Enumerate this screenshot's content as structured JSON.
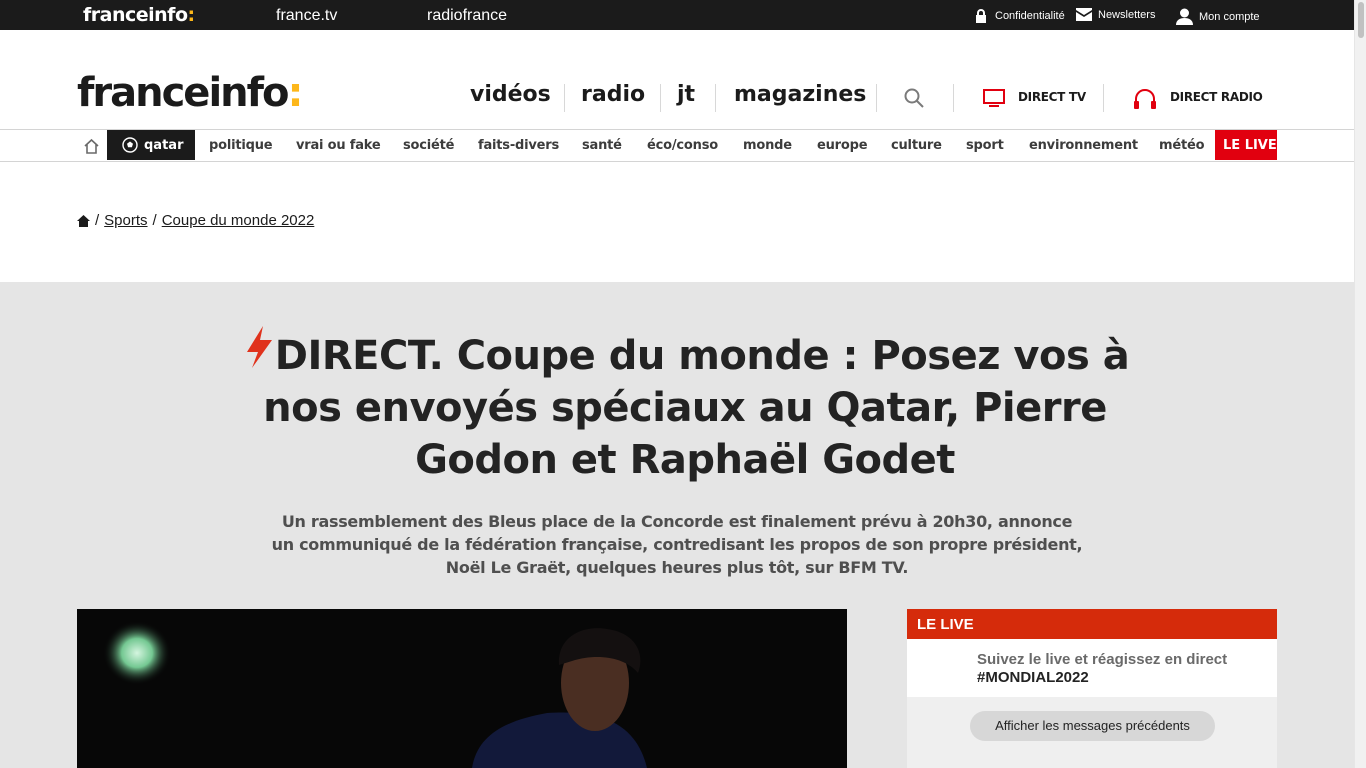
{
  "topbar": {
    "brand": "franceinfo",
    "brand_colon": ":",
    "links": [
      "france.tv",
      "radiofrance"
    ],
    "utilities": [
      "Confidentialité",
      "Newsletters",
      "Mon compte"
    ]
  },
  "header": {
    "logo": "franceinfo",
    "logo_colon": ":",
    "nav": [
      "vidéos",
      "radio",
      "jt",
      "magazines"
    ],
    "direct_tv": "DIRECT TV",
    "direct_radio": "DIRECT RADIO"
  },
  "categories": {
    "qatar": "qatar",
    "items": [
      "politique",
      "vrai ou fake",
      "société",
      "faits-divers",
      "santé",
      "éco/conso",
      "monde",
      "europe",
      "culture",
      "sport",
      "environnement",
      "météo"
    ],
    "live": "LE LIVE"
  },
  "breadcrumb": {
    "separator": "/",
    "items": [
      "Sports",
      "Coupe du monde 2022"
    ]
  },
  "article": {
    "headline": "DIRECT. Coupe du monde : Posez vos à nos envoyés spéciaux au Qatar, Pierre Godon et Raphaël Godet",
    "chapo": "Un rassemblement des Bleus place de la Concorde est finalement prévu à 20h30, annonce un communiqué de la fédération française, contredisant les propos de son propre président, Noël Le Graët, quelques heures plus tôt, sur BFM TV."
  },
  "live_box": {
    "title": "LE LIVE",
    "intro": "Suivez le live et réagissez en direct",
    "hashtag": "#MONDIAL2022",
    "button": "Afficher les messages précédents"
  },
  "colors": {
    "accent_yellow": "#fdb71a",
    "live_red": "#e1000f",
    "live_box_red": "#d52b0b",
    "bolt_red": "#e0321c"
  },
  "icons": [
    "lock-icon",
    "mail-icon",
    "user-icon",
    "search-icon",
    "tv-icon",
    "headphones-icon",
    "home-icon",
    "football-icon",
    "bolt-icon"
  ]
}
